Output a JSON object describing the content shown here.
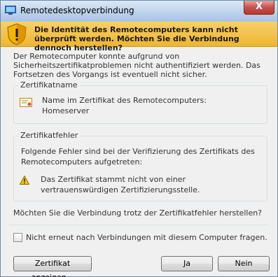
{
  "window": {
    "title": "Remotedesktopverbindung",
    "close_label": "X",
    "icons": {
      "app": "remote-desktop-icon",
      "close": "close-icon"
    }
  },
  "warning": {
    "icon": "shield-warning-icon",
    "headline": "Die Identität des Remotecomputers kann nicht überprüft werden. Möchten Sie die Verbindung dennoch herstellen?"
  },
  "intro": "Der Remotecomputer konnte aufgrund von Sicherheitszertifikatproblemen nicht authentifiziert werden. Das Fortsetzen des Vorgangs ist eventuell nicht sicher.",
  "cert_group": {
    "label": "Zertifikatname",
    "icon": "certificate-icon",
    "name_label": "Name im Zertifikat des Remotecomputers:",
    "name_value": "Homeserver"
  },
  "error_group": {
    "label": "Zertifikatfehler",
    "text": "Folgende Fehler sind bei der Verifizierung des Zertifikats des Remotecomputers aufgetreten:",
    "icon": "warning-triangle-icon",
    "error": "Das Zertifikat stammt nicht von einer vertrauenswürdigen Zertifizierungsstelle."
  },
  "question": "Möchten Sie die Verbindung trotz der Zertifikatfehler herstellen?",
  "dont_ask": {
    "label": "Nicht erneut nach Verbindungen mit diesem Computer fragen.",
    "checked": false
  },
  "buttons": {
    "view_cert": "Zertifikat anzeigen...",
    "yes": "Ja",
    "no": "Nein"
  },
  "colors": {
    "warning_band": "#efb530",
    "close_button": "#c75050",
    "titlebar": "#b9d1ea"
  }
}
